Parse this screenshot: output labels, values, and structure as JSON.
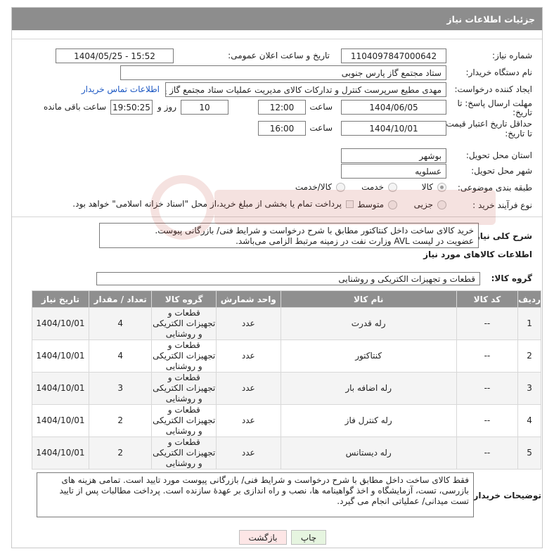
{
  "title": "جزئیات اطلاعات نیاز",
  "form": {
    "need_number_label": "شماره نیاز:",
    "need_number": "1104097847000642",
    "announce_label": "تاریخ و ساعت اعلان عمومی:",
    "announce_value": "1404/05/25 - 15:52",
    "buyer_org_label": "نام دستگاه خریدار:",
    "buyer_org": "ستاد مجتمع گاز پارس جنوبی",
    "creator_label": "ایجاد کننده درخواست:",
    "creator": "مهدی مطیع سرپرست کنترل و تدارکات کالای مدیریت عملیات ستاد مجتمع گاز پا",
    "contact_link": "اطلاعات تماس خریدار",
    "reply_deadline_label_1": "مهلت ارسال پاسخ: تا",
    "reply_deadline_label_2": "تاریخ:",
    "reply_date": "1404/06/05",
    "time_label": "ساعت",
    "reply_time": "12:00",
    "days_value": "10",
    "days_label": "روز و",
    "remaining_time": "19:50:25",
    "remaining_label": "ساعت باقی مانده",
    "price_deadline_label_1": "حداقل تاریخ اعتبار قیمت:",
    "price_deadline_label_2": "تا تاریخ:",
    "price_date": "1404/10/01",
    "price_time": "16:00",
    "province_label": "استان محل تحویل:",
    "province": "بوشهر",
    "city_label": "شهر محل تحویل:",
    "city": "عسلویه",
    "category_label": "طبقه بندی موضوعی:",
    "category_options": [
      "کالا",
      "خدمت",
      "کالا/خدمت"
    ],
    "process_label": "نوع فرآیند خرید :",
    "process_options": [
      "جزیی",
      "متوسط"
    ],
    "payment_note": "پرداخت تمام یا بخشی از مبلغ خرید،از محل \"اسناد خزانه اسلامی\" خواهد بود."
  },
  "need_desc": {
    "label": "شرح کلی نیاز:",
    "text": "خرید کالای ساخت داخل کنتاکتور مطابق با شرح درخواست و شرایط فنی/ بازرگانی پیوست.\nعضویت در لیست AVL وزارت نفت در زمینه مرتبط الزامی می‌باشد."
  },
  "goods": {
    "section_title": "اطلاعات کالاهای مورد نیاز",
    "group_label": "گروه کالا:",
    "group_value": "قطعات و تجهیزات الکتریکی و روشنایی"
  },
  "table": {
    "headers": [
      "ردیف",
      "کد کالا",
      "نام کالا",
      "واحد شمارش",
      "گروه کالا",
      "تعداد / مقدار",
      "تاریخ نیاز"
    ],
    "rows": [
      {
        "row": "1",
        "code": "--",
        "name": "رله قدرت",
        "unit": "عدد",
        "group": "قطعات و تجهیزات الکتریکی و روشنایی",
        "qty": "4",
        "date": "1404/10/01"
      },
      {
        "row": "2",
        "code": "--",
        "name": "کنتاکتور",
        "unit": "عدد",
        "group": "قطعات و تجهیزات الکتریکی و روشنایی",
        "qty": "4",
        "date": "1404/10/01"
      },
      {
        "row": "3",
        "code": "--",
        "name": "رله اضافه بار",
        "unit": "عدد",
        "group": "قطعات و تجهیزات الکتریکی و روشنایی",
        "qty": "3",
        "date": "1404/10/01"
      },
      {
        "row": "4",
        "code": "--",
        "name": "رله کنترل فاز",
        "unit": "عدد",
        "group": "قطعات و تجهیزات الکتریکی و روشنایی",
        "qty": "2",
        "date": "1404/10/01"
      },
      {
        "row": "5",
        "code": "--",
        "name": "رله دیستانس",
        "unit": "عدد",
        "group": "قطعات و تجهیزات الکتریکی و روشنایی",
        "qty": "2",
        "date": "1404/10/01"
      }
    ]
  },
  "buyer_notes": {
    "label": "توضیحات خریدار:",
    "text": "فقط کالای ساخت داخل مطابق با شرح درخواست و شرایط فنی/ بازرگانی پیوست مورد تایید است. تمامی هزینه های بازرسی، تست، آزمایشگاه و اخذ گواهینامه ها، نصب و راه اندازی بر عهدهٔ سازنده است. پرداخت مطالبات پس از تایید تست میدانی/ عملیاتی انجام می گیرد."
  },
  "buttons": {
    "print": "چاپ",
    "back": "بازگشت"
  },
  "colors": {
    "header_bg": "#8d8d8d",
    "link": "#1a56c2",
    "print_button_bg": "#e6f5e0",
    "back_button_bg": "#fde6e6"
  }
}
